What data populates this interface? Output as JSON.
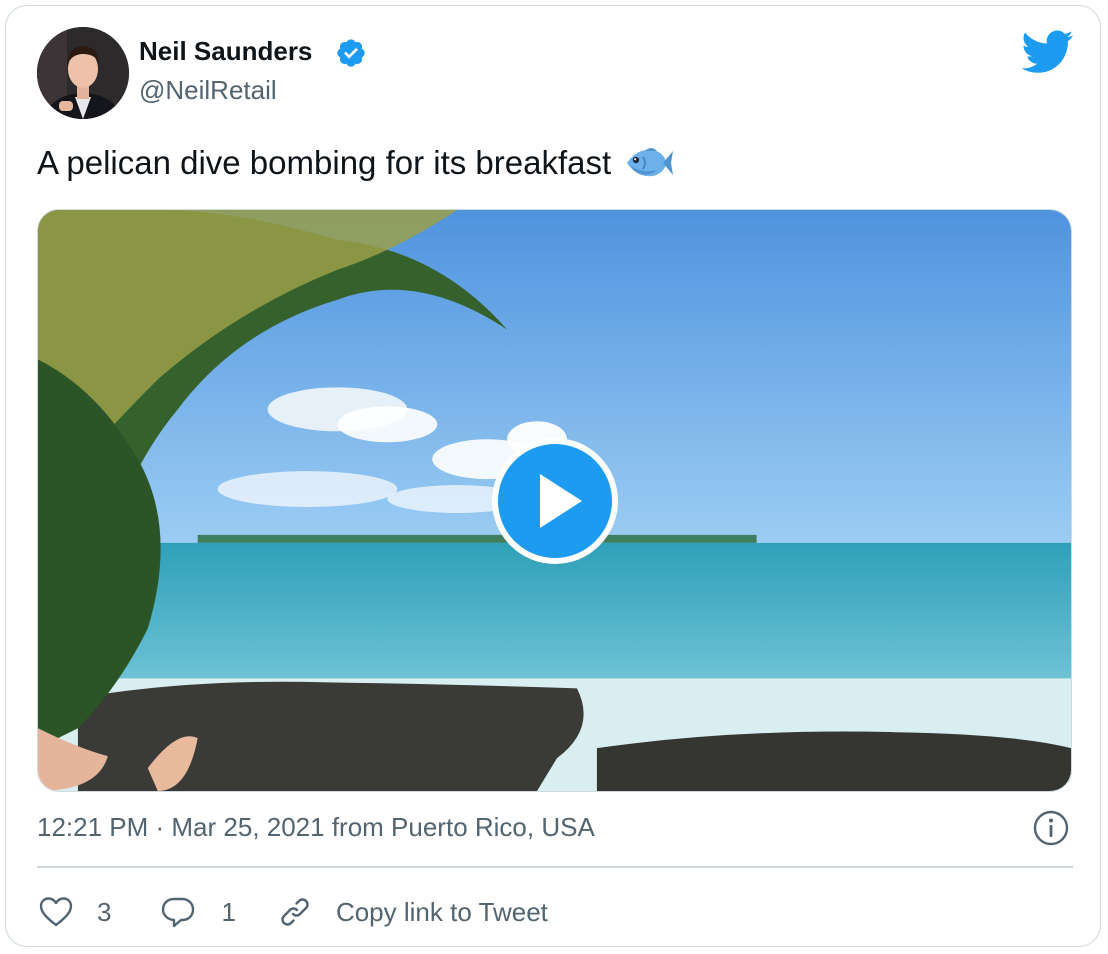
{
  "author": {
    "name": "Neil Saunders",
    "handle": "@NeilRetail",
    "verified": true
  },
  "tweet": {
    "text": "A pelican dive bombing for its breakfast",
    "emoji": "fish-emoji"
  },
  "media": {
    "type": "video",
    "play_icon": "play-icon"
  },
  "meta": {
    "timestamp": "12:21 PM · Mar 25, 2021 from Puerto Rico, USA"
  },
  "actions": {
    "like_count": "3",
    "reply_count": "1",
    "copy_link_label": "Copy link to Tweet"
  },
  "colors": {
    "twitter_blue": "#1d9bf0",
    "text_primary": "#0f1419",
    "text_secondary": "#536471",
    "border": "#cfd9de"
  }
}
